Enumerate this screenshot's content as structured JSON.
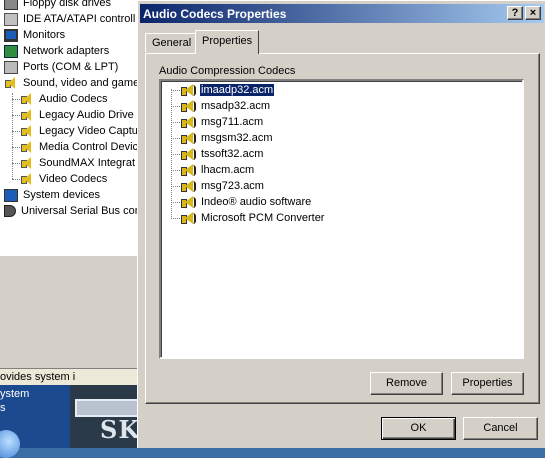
{
  "background": {
    "tree_items": [
      {
        "label": "Floppy disk drives",
        "icon": "floppy-icon",
        "indent": 0
      },
      {
        "label": "IDE ATA/ATAPI controll",
        "icon": "ide-controller-icon",
        "indent": 0
      },
      {
        "label": "Monitors",
        "icon": "monitor-icon",
        "indent": 0
      },
      {
        "label": "Network adapters",
        "icon": "network-card-icon",
        "indent": 0
      },
      {
        "label": "Ports (COM & LPT)",
        "icon": "port-icon",
        "indent": 0
      },
      {
        "label": "Sound, video and game",
        "icon": "speaker-icon",
        "indent": 0
      },
      {
        "label": "Audio Codecs",
        "icon": "speaker-icon",
        "indent": 1
      },
      {
        "label": "Legacy Audio Drive",
        "icon": "speaker-icon",
        "indent": 1
      },
      {
        "label": "Legacy Video Captu",
        "icon": "speaker-icon",
        "indent": 1
      },
      {
        "label": "Media Control Devic",
        "icon": "speaker-icon",
        "indent": 1
      },
      {
        "label": "SoundMAX Integrat",
        "icon": "speaker-icon",
        "indent": 1
      },
      {
        "label": "Video Codecs",
        "icon": "speaker-icon",
        "indent": 1
      },
      {
        "label": "System devices",
        "icon": "system-devices-icon",
        "indent": 0
      },
      {
        "label": "Universal Serial Bus con",
        "icon": "usb-icon",
        "indent": 0
      }
    ],
    "status_strip": "ovides system i",
    "blue_panel_lines": [
      "ystem",
      "s"
    ],
    "poster_text": "SK"
  },
  "dialog": {
    "title": "Audio Codecs Properties",
    "help_button": "?",
    "close_button": "×",
    "tabs": [
      {
        "label": "General",
        "active": false
      },
      {
        "label": "Properties",
        "active": true
      }
    ],
    "group_label": "Audio Compression Codecs",
    "codecs": [
      {
        "label": "imaadp32.acm",
        "selected": true
      },
      {
        "label": "msadp32.acm",
        "selected": false
      },
      {
        "label": "msg711.acm",
        "selected": false
      },
      {
        "label": "msgsm32.acm",
        "selected": false
      },
      {
        "label": "tssoft32.acm",
        "selected": false
      },
      {
        "label": "lhacm.acm",
        "selected": false
      },
      {
        "label": "msg723.acm",
        "selected": false
      },
      {
        "label": "Indeo® audio software",
        "selected": false
      },
      {
        "label": "Microsoft PCM Converter",
        "selected": false
      }
    ],
    "buttons": {
      "remove": "Remove",
      "properties": "Properties",
      "ok": "OK",
      "cancel": "Cancel"
    }
  },
  "colors": {
    "titlebar_start": "#0a246a",
    "titlebar_end": "#a6caf0",
    "face": "#d4d0c8",
    "selection": "#0a246a"
  }
}
